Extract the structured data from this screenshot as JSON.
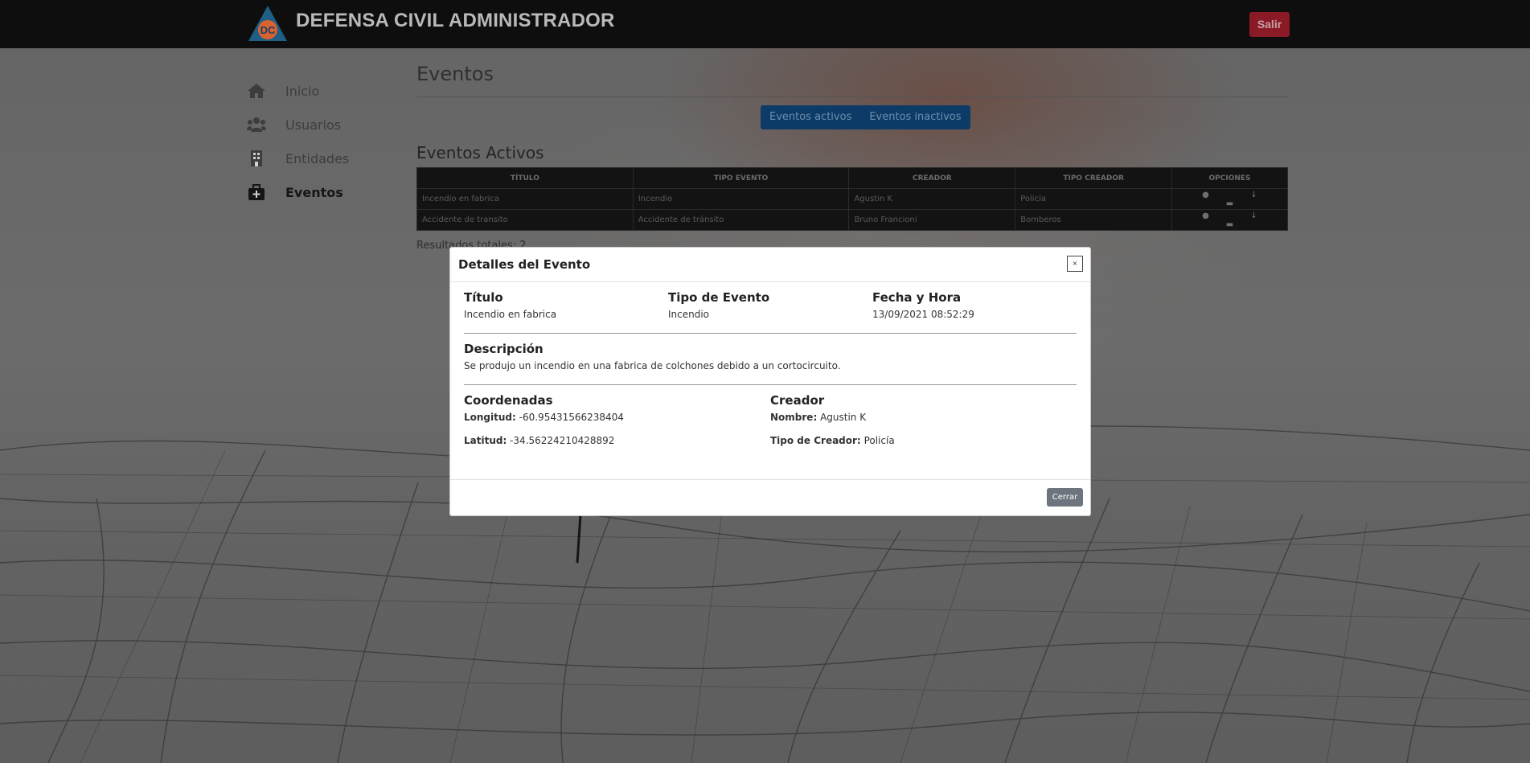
{
  "app": {
    "brand": "DEFENSA CIVIL ADMINISTRADOR",
    "logo_text": "DC",
    "logout_label": "Salir"
  },
  "sidebar": {
    "items": [
      {
        "label": "Inicio",
        "icon": "home-icon"
      },
      {
        "label": "Usuarios",
        "icon": "users-icon"
      },
      {
        "label": "Entidades",
        "icon": "building-icon"
      },
      {
        "label": "Eventos",
        "icon": "medical-case-icon",
        "active": true
      }
    ]
  },
  "main": {
    "title": "Eventos",
    "tabs": [
      "Eventos activos",
      "Eventos inactivos"
    ],
    "section_title": "Eventos Activos",
    "table": {
      "headers": [
        "TÍTULO",
        "TIPO EVENTO",
        "CREADOR",
        "TIPO CREADOR",
        "OPCIONES"
      ],
      "rows": [
        {
          "titulo": "Incendio en fabrica",
          "tipo": "Incendio",
          "creador": "Agustin K",
          "tipo_creador": "Policía"
        },
        {
          "titulo": "Accidente de transito",
          "tipo": "Accidente de tránsito",
          "creador": "Bruno Francioni",
          "tipo_creador": "Bomberos"
        }
      ],
      "option_icons": [
        "info-icon",
        "arrow-down-icon",
        "minus-icon"
      ]
    },
    "results": "Resultados totales: 2"
  },
  "modal": {
    "title": "Detalles del Evento",
    "close_symbol": "×",
    "titulo_label": "Título",
    "titulo_value": "Incendio en fabrica",
    "tipo_label": "Tipo de Evento",
    "tipo_value": "Incendio",
    "fecha_label": "Fecha y Hora",
    "fecha_value": "13/09/2021 08:52:29",
    "descripcion_label": "Descripción",
    "descripcion_value": "Se produjo un incendio en una fabrica de colchones debido a un cortocircuito.",
    "coordenadas_label": "Coordenadas",
    "longitud_label": "Longitud:",
    "longitud_value": "-60.95431566238404",
    "latitud_label": "Latitud:",
    "latitud_value": "-34.56224210428892",
    "creador_label": "Creador",
    "nombre_label": "Nombre:",
    "nombre_value": "Agustin K",
    "tipo_creador_label": "Tipo de Creador:",
    "tipo_creador_value": "Policía",
    "close_button": "Cerrar"
  },
  "colors": {
    "navbar": "#0e0e0e",
    "danger": "#8a1a26",
    "primary": "#0c3b68",
    "secondary": "#6c757d"
  }
}
